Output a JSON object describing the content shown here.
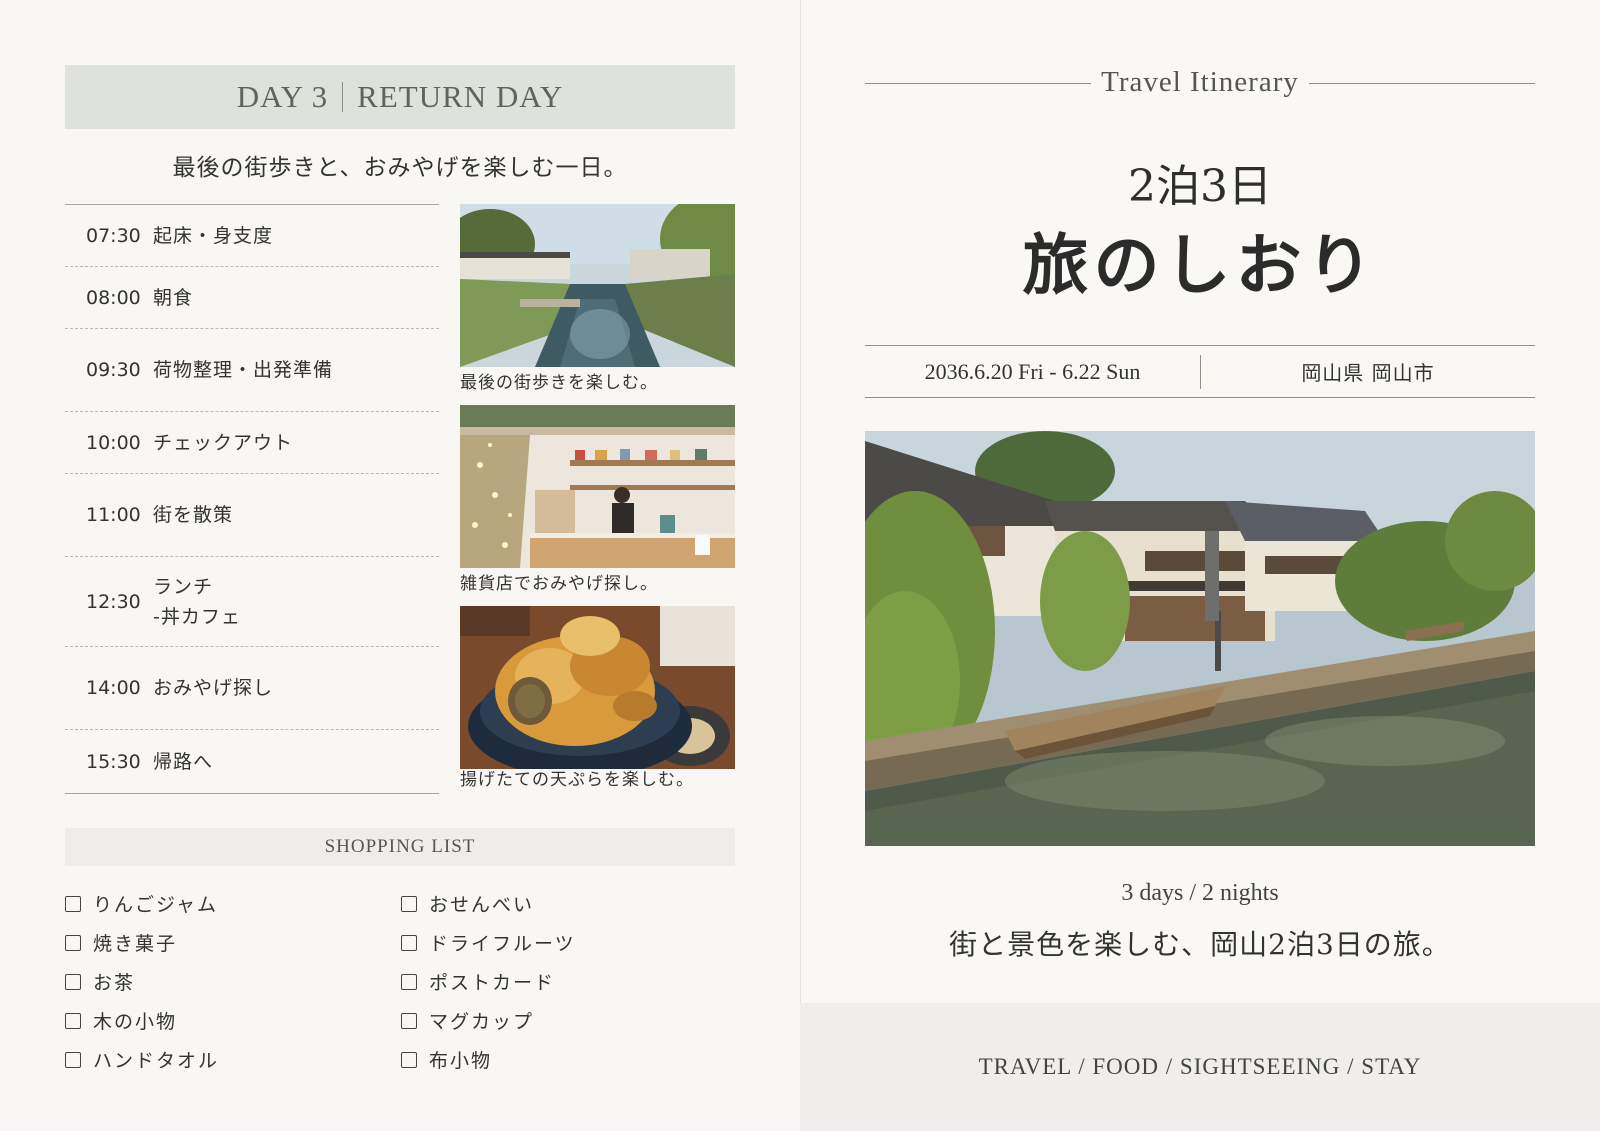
{
  "left": {
    "day_label": "DAY 3",
    "day_title": "RETURN DAY",
    "subtitle": "最後の街歩きと、おみやげを楽しむ一日。",
    "schedule": [
      {
        "time": "07:30",
        "activity": "起床・身支度"
      },
      {
        "time": "08:00",
        "activity": "朝食"
      },
      {
        "time": "09:30",
        "activity": "荷物整理・出発準備"
      },
      {
        "time": "10:00",
        "activity": "チェックアウト"
      },
      {
        "time": "11:00",
        "activity": "街を散策"
      },
      {
        "time": "12:30",
        "activity": "ランチ\n-丼カフェ"
      },
      {
        "time": "14:00",
        "activity": "おみやげ探し"
      },
      {
        "time": "15:30",
        "activity": "帰路へ"
      }
    ],
    "photos": [
      {
        "caption": "最後の街歩きを楽しむ。"
      },
      {
        "caption": "雑貨店でおみやげ探し。"
      },
      {
        "caption": "揚げたての天ぷらを楽しむ。"
      }
    ],
    "shopping_title": "SHOPPING LIST",
    "shopping_col1": [
      "りんごジャム",
      "焼き菓子",
      "お茶",
      "木の小物",
      "ハンドタオル"
    ],
    "shopping_col2": [
      "おせんべい",
      "ドライフルーツ",
      "ポストカード",
      "マグカップ",
      "布小物"
    ]
  },
  "right": {
    "header": "Travel Itinerary",
    "nights": "2泊3日",
    "title": "旅のしおり",
    "dates": "2036.6.20 Fri - 6.22 Sun",
    "place": "岡山県 岡山市",
    "days_nights": "3 days / 2 nights",
    "tagline": "街と景色を楽しむ、岡山2泊3日の旅。",
    "footer": "TRAVEL / FOOD / SIGHTSEEING / STAY"
  }
}
